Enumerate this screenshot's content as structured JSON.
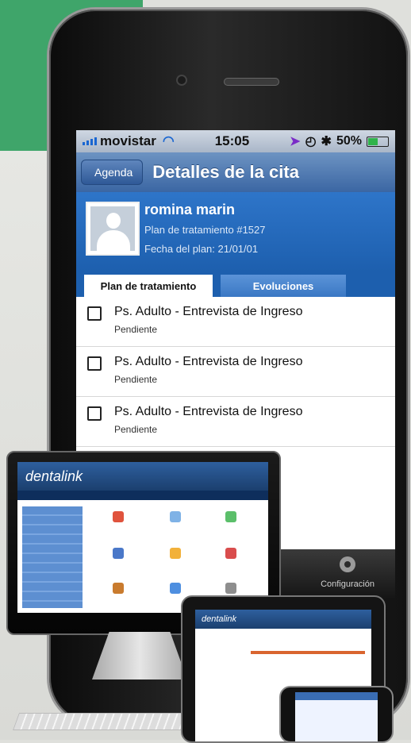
{
  "status_bar": {
    "carrier": "movistar",
    "time": "15:05",
    "battery": "50%"
  },
  "nav": {
    "back_label": "Agenda",
    "title": "Detalles de la cita"
  },
  "patient": {
    "name": "romina marin",
    "plan": "Plan de tratamiento #1527",
    "plan_date": "Fecha del plan: 21/01/01"
  },
  "tabs": [
    {
      "label": "Plan de tratamiento",
      "active": true
    },
    {
      "label": "Evoluciones",
      "active": false
    }
  ],
  "items": [
    {
      "title": "Ps. Adulto - Entrevista de Ingreso",
      "status": "Pendiente"
    },
    {
      "title": "Ps. Adulto - Entrevista de Ingreso",
      "status": "Pendiente"
    },
    {
      "title": "Ps. Adulto - Entrevista de Ingreso",
      "status": "Pendiente"
    }
  ],
  "tabbar": {
    "settings_label": "Configuración"
  },
  "brand": {
    "logo_text": "dentalink"
  },
  "colors": {
    "green": "#3fa56a",
    "blue": "#1d5fae"
  }
}
